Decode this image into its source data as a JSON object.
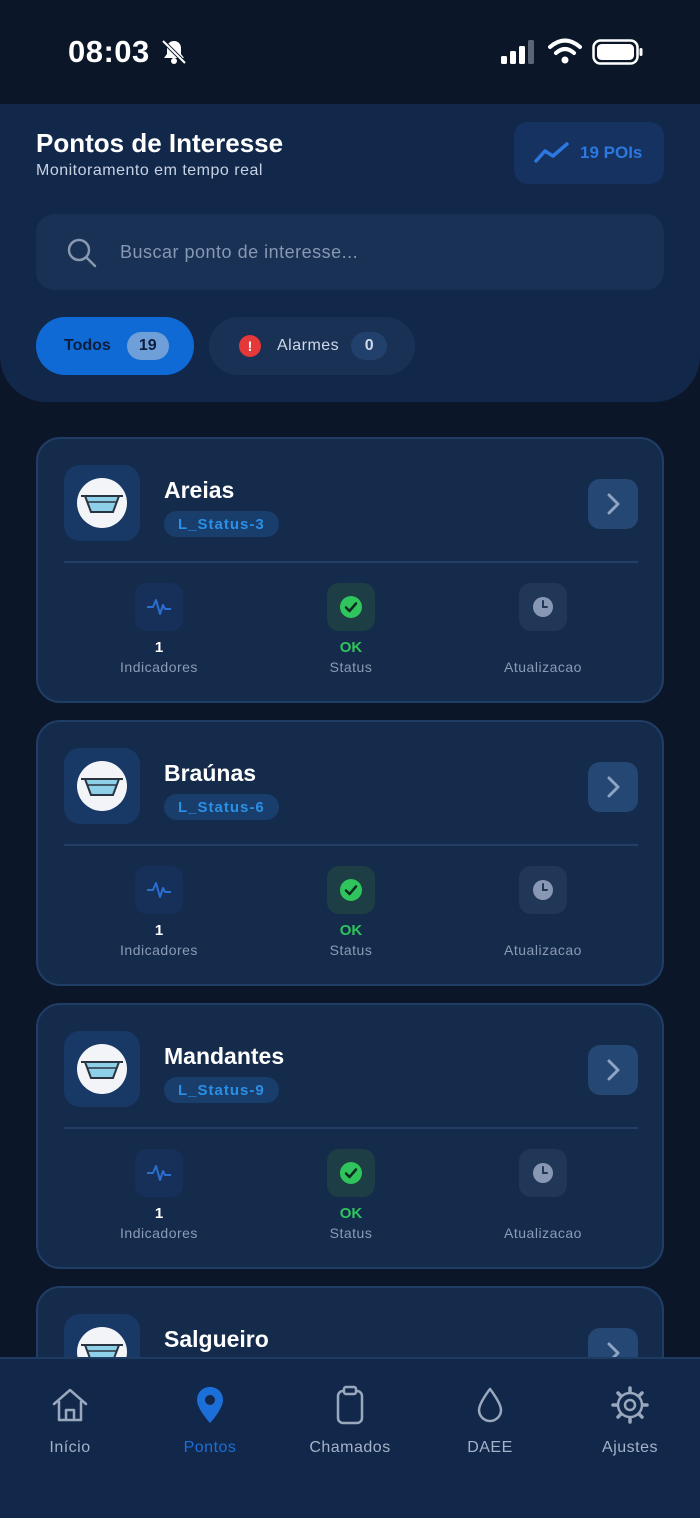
{
  "status_bar": {
    "time": "08:03"
  },
  "header": {
    "title": "Pontos de Interesse",
    "subtitle": "Monitoramento em tempo real",
    "poi_count_label": "19 POIs"
  },
  "search": {
    "placeholder": "Buscar ponto de interesse..."
  },
  "filters": {
    "all": {
      "label": "Todos",
      "count": "19"
    },
    "alarms": {
      "label": "Alarmes",
      "count": "0"
    }
  },
  "cards": [
    {
      "name": "Areias",
      "tag": "L_Status-3",
      "indicators_value": "1",
      "indicators_label": "Indicadores",
      "status_value": "OK",
      "status_label": "Status",
      "update_label": "Atualizacao"
    },
    {
      "name": "Braúnas",
      "tag": "L_Status-6",
      "indicators_value": "1",
      "indicators_label": "Indicadores",
      "status_value": "OK",
      "status_label": "Status",
      "update_label": "Atualizacao"
    },
    {
      "name": "Mandantes",
      "tag": "L_Status-9",
      "indicators_value": "1",
      "indicators_label": "Indicadores",
      "status_value": "OK",
      "status_label": "Status",
      "update_label": "Atualizacao"
    },
    {
      "name": "Salgueiro"
    }
  ],
  "nav": [
    {
      "label": "Início",
      "icon": "home-icon"
    },
    {
      "label": "Pontos",
      "icon": "map-pin-icon",
      "active": true
    },
    {
      "label": "Chamados",
      "icon": "clipboard-icon"
    },
    {
      "label": "DAEE",
      "icon": "water-drop-icon"
    },
    {
      "label": "Ajustes",
      "icon": "gear-icon"
    }
  ],
  "colors": {
    "background": "#0b1628",
    "panel": "#12284a",
    "accent": "#0f6ad6",
    "ok": "#2fc45c",
    "alarm": "#e53838"
  }
}
